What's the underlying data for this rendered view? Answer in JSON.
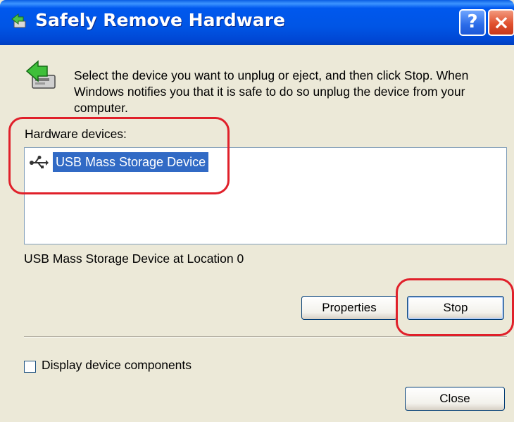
{
  "window": {
    "title": "Safely Remove Hardware",
    "help_button": "?",
    "close_button": "×"
  },
  "intro": {
    "text": "Select the device you want to unplug or eject, and then click Stop. When Windows notifies you that it is safe to do so unplug the device from your computer.",
    "icon": "eject-hardware-icon"
  },
  "hardware_list": {
    "label": "Hardware devices:",
    "items": [
      {
        "label": "USB Mass Storage Device",
        "icon": "usb-icon",
        "selected": true
      }
    ]
  },
  "location_text": "USB Mass Storage Device at Location 0",
  "buttons": {
    "properties": "Properties",
    "stop": "Stop",
    "close": "Close"
  },
  "checkbox": {
    "label": "Display device components",
    "checked": false
  },
  "colors": {
    "titlebar": "#0055e5",
    "selection": "#316ac5",
    "annotation": "#e0202a",
    "dialog_bg": "#ece9d8"
  }
}
